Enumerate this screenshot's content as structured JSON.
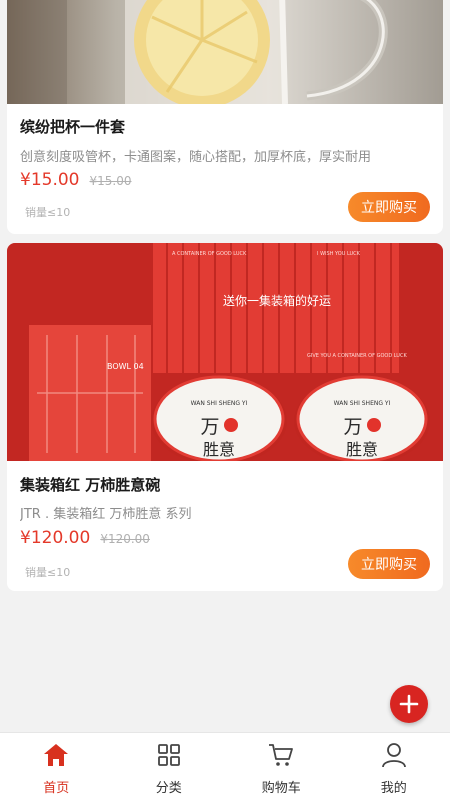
{
  "products": [
    {
      "title": "缤纷把杯一件套",
      "description": "创意刻度吸管杯，卡通图案，随心搭配，加厚杯底，厚实耐用",
      "price": "¥15.00",
      "original_price": "¥15.00",
      "sales": "销量≤10",
      "buy_label": "立即购买"
    },
    {
      "title": "集装箱红 万柿胜意碗",
      "description": "JTR . 集装箱红 万柿胜意 系列",
      "price": "¥120.00",
      "original_price": "¥120.00",
      "sales": "销量≤10",
      "buy_label": "立即购买",
      "image_text": {
        "container_slogan": "送你一集装箱的好运",
        "container_small_1": "A CONTAINER OF GOOD LUCK",
        "container_small_2": "I WISH YOU LUCK",
        "container_small_3": "GIVE YOU A CONTAINER OF GOOD LUCK",
        "box_label": "BOWL 04",
        "bowl_arc": "WAN SHI SHENG YI",
        "bowl_chars_top": "万",
        "bowl_chars_bottom": "胜意"
      }
    }
  ],
  "fab_icon": "plus-icon",
  "tabbar": {
    "tabs": [
      {
        "label": "首页",
        "icon": "home-icon",
        "active": true
      },
      {
        "label": "分类",
        "icon": "grid-icon",
        "active": false
      },
      {
        "label": "购物车",
        "icon": "cart-icon",
        "active": false
      },
      {
        "label": "我的",
        "icon": "user-icon",
        "active": false
      }
    ]
  },
  "colors": {
    "accent": "#d8311f",
    "price": "#e4392a",
    "button": "#f47a24"
  }
}
